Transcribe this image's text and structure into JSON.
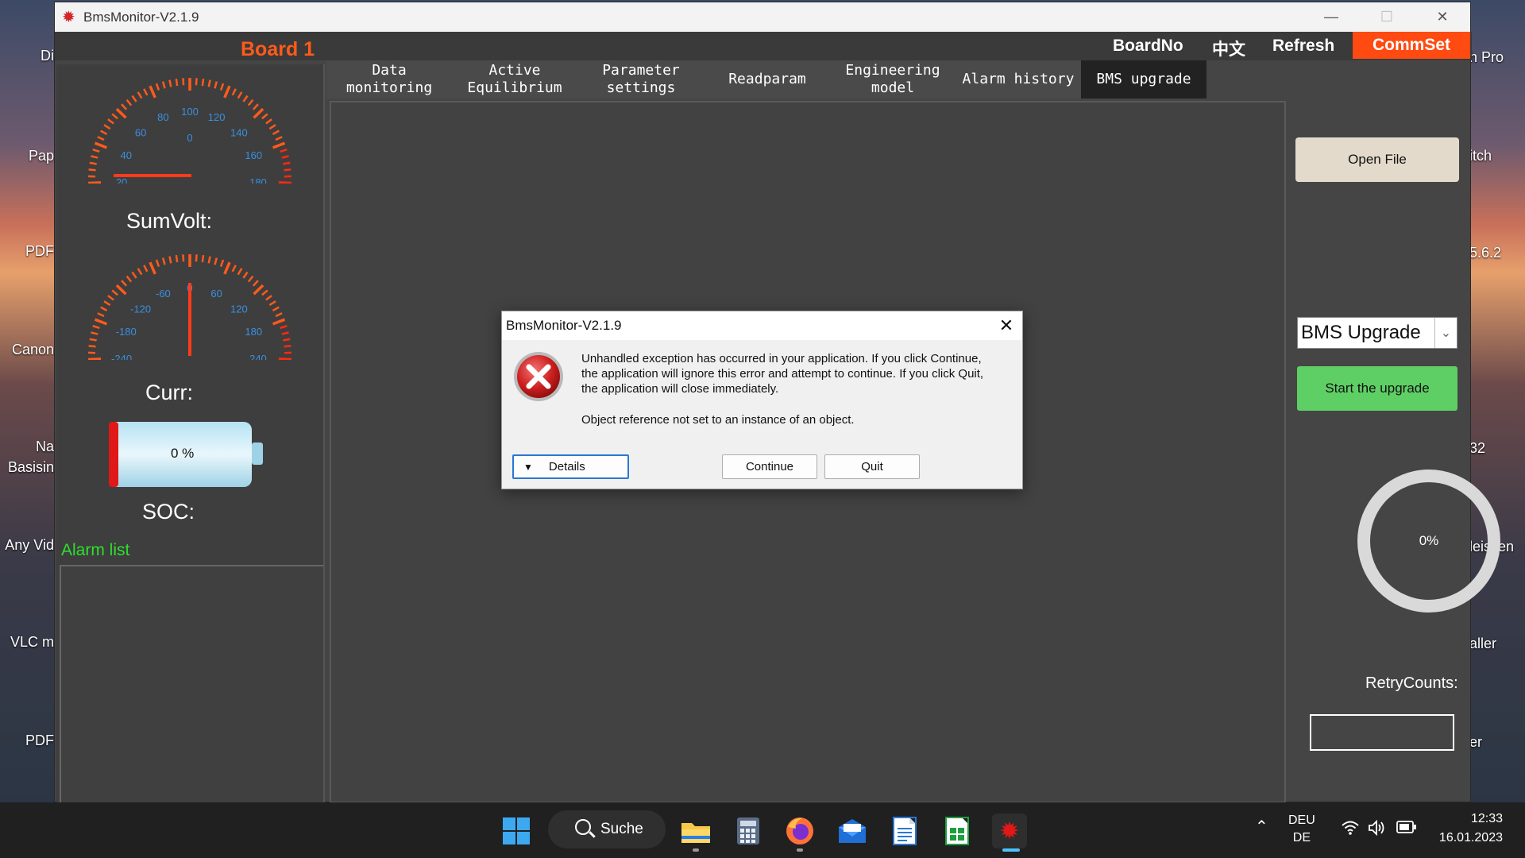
{
  "desktop": {
    "left_icons": [
      "Di",
      "Pap",
      "PDF",
      "Canon",
      "Na",
      "Basisin",
      "Any Vid",
      "VLC m",
      "PDF"
    ],
    "right_icons": [
      "h Pro",
      "itch",
      "5.6.2",
      "32",
      "leissen",
      "aller",
      "er"
    ]
  },
  "window": {
    "title": "BmsMonitor-V2.1.9",
    "controls": {
      "minimize": "—",
      "maximize": "☐",
      "close": "✕"
    }
  },
  "topbar": {
    "board": "Board 1",
    "boardno": "BoardNo",
    "language": "中文",
    "refresh": "Refresh",
    "commset": "CommSet"
  },
  "tabs": [
    {
      "line1": "Data",
      "line2": "monitoring"
    },
    {
      "line1": "Active",
      "line2": "Equilibrium"
    },
    {
      "line1": "Parameter",
      "line2": "settings"
    },
    {
      "line1": "Readparam",
      "line2": ""
    },
    {
      "line1": "Engineering",
      "line2": "model"
    },
    {
      "line1": "Alarm history",
      "line2": ""
    },
    {
      "line1": "BMS upgrade",
      "line2": ""
    }
  ],
  "left": {
    "gauge1": {
      "label": "SumVolt:",
      "ticks": [
        "0",
        "20",
        "40",
        "60",
        "80",
        "100",
        "120",
        "140",
        "160",
        "180",
        "200"
      ],
      "center": "0"
    },
    "gauge2": {
      "label": "Curr:",
      "ticks": [
        "-300",
        "-240",
        "-180",
        "-120",
        "-60",
        "0",
        "60",
        "120",
        "180",
        "240",
        "300"
      ]
    },
    "battery": {
      "value": "0 %",
      "level": 0
    },
    "soc_label": "SOC:",
    "alarm_label": "Alarm list"
  },
  "right": {
    "open_file": "Open File",
    "mode_select": "BMS Upgrade",
    "start": "Start the upgrade",
    "progress_text": "0%",
    "progress": 0,
    "retry_label": "RetryCounts:",
    "retry_value": ""
  },
  "dialog": {
    "title": "BmsMonitor-V2.1.9",
    "message": "Unhandled exception has occurred in your application. If you click Continue, the application will ignore this error and attempt to continue. If you click Quit, the application will close immediately.",
    "error": "Object reference not set to an instance of an object.",
    "details": "Details",
    "continue": "Continue",
    "quit": "Quit"
  },
  "taskbar": {
    "search": "Suche",
    "lang1": "DEU",
    "lang2": "DE",
    "time": "12:33",
    "date": "16.01.2023"
  },
  "colors": {
    "accent_orange": "#ff4a12",
    "gauge_ticks": "#ff3b1a",
    "gauge_numbers": "#3a8fe0",
    "alarm_green": "#2de02d",
    "start_green": "#5ecf64"
  }
}
